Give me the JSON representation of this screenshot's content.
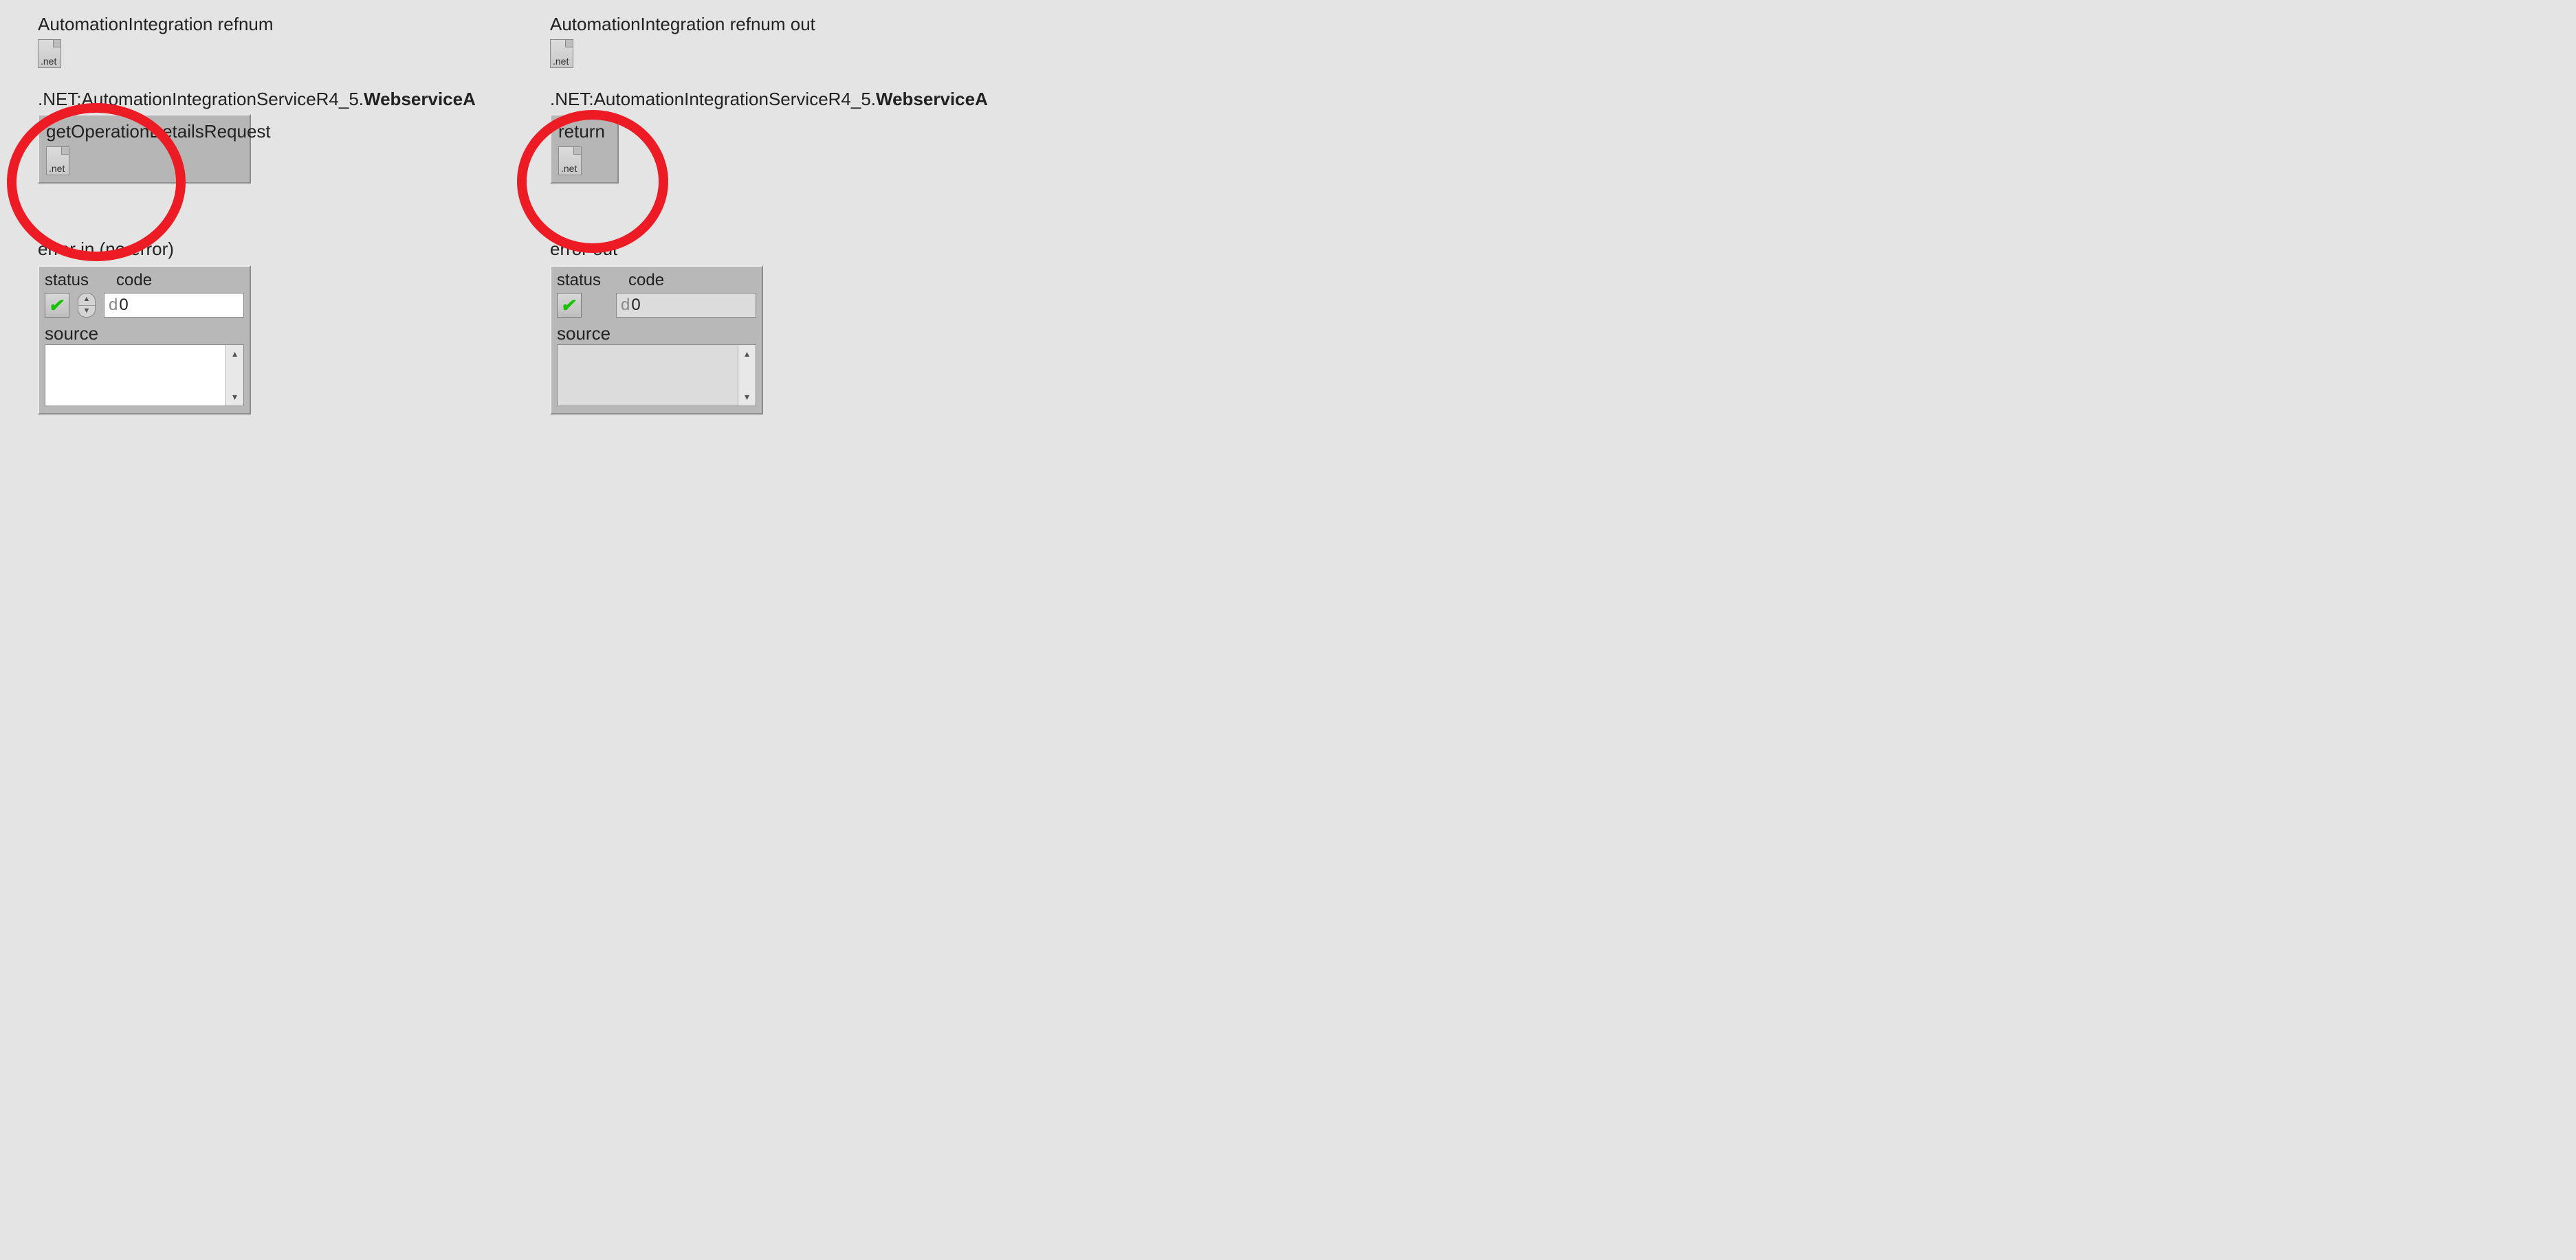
{
  "netIconText": ".net",
  "left": {
    "refnumLabel": "AutomationIntegration refnum",
    "typePrefix": ".NET:AutomationIntegrationServiceR4_5.",
    "typeSuffix": "WebserviceA",
    "clusterCaption": "getOperationDetailsRequest",
    "error": {
      "title": "error in (no error)",
      "statusLabel": "status",
      "codeLabel": "code",
      "codeValue": "0",
      "sourceLabel": "source",
      "sourceValue": ""
    }
  },
  "right": {
    "refnumLabel": "AutomationIntegration refnum out",
    "typePrefix": ".NET:AutomationIntegrationServiceR4_5.",
    "typeSuffix": "WebserviceA",
    "clusterCaption": "return",
    "error": {
      "title": "error out",
      "statusLabel": "status",
      "codeLabel": "code",
      "codeValue": "0",
      "sourceLabel": "source",
      "sourceValue": ""
    }
  }
}
